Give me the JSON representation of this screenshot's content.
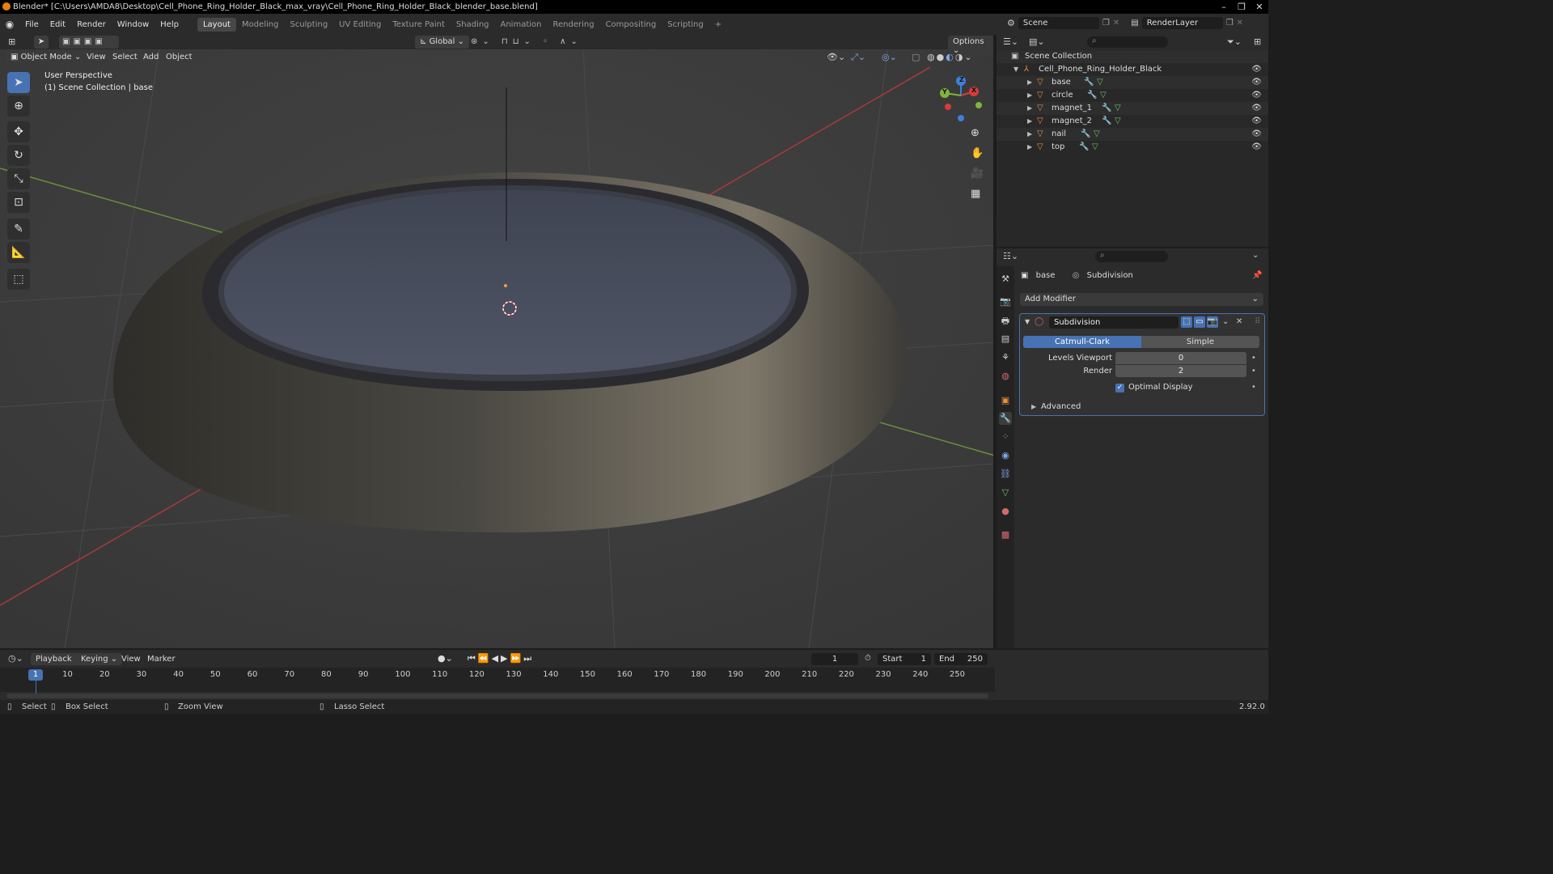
{
  "window": {
    "title": "Blender* [C:\\Users\\AMDA8\\Desktop\\Cell_Phone_Ring_Holder_Black_max_vray\\Cell_Phone_Ring_Holder_Black_blender_base.blend]"
  },
  "menu": [
    "File",
    "Edit",
    "Render",
    "Window",
    "Help"
  ],
  "workspaces": [
    "Layout",
    "Modeling",
    "Sculpting",
    "UV Editing",
    "Texture Paint",
    "Shading",
    "Animation",
    "Rendering",
    "Compositing",
    "Scripting"
  ],
  "active_workspace": "Layout",
  "add_workspace": "+",
  "scene": {
    "name": "Scene",
    "render_layer": "RenderLayer"
  },
  "viewport": {
    "orientation": "Global",
    "options_label": "Options",
    "mode": "Object Mode",
    "menus": [
      "View",
      "Select",
      "Add",
      "Object"
    ],
    "overlay_title": "User Perspective",
    "overlay_subtitle": "(1) Scene Collection | base",
    "gizmo": {
      "x": "X",
      "y": "Y",
      "z": "Z"
    }
  },
  "outliner": {
    "root": "Scene Collection",
    "collection": "Cell_Phone_Ring_Holder_Black",
    "objects": [
      "base",
      "circle",
      "magnet_1",
      "magnet_2",
      "nail",
      "top"
    ]
  },
  "properties": {
    "object_name": "base",
    "modifier_context": "Subdivision",
    "add_modifier": "Add Modifier",
    "modifier": {
      "name": "Subdivision",
      "type_a": "Catmull-Clark",
      "type_b": "Simple",
      "levels_viewport_label": "Levels Viewport",
      "levels_viewport": "0",
      "render_label": "Render",
      "render": "2",
      "optimal_display_label": "Optimal Display",
      "optimal_display": true,
      "advanced_label": "Advanced"
    }
  },
  "timeline": {
    "menus": [
      "Playback",
      "Keying",
      "View",
      "Marker"
    ],
    "current_frame": "1",
    "start_label": "Start",
    "start": "1",
    "end_label": "End",
    "end": "250",
    "ticks": [
      "1",
      "10",
      "20",
      "30",
      "40",
      "50",
      "60",
      "70",
      "80",
      "90",
      "100",
      "110",
      "120",
      "130",
      "140",
      "150",
      "160",
      "170",
      "180",
      "190",
      "200",
      "210",
      "220",
      "230",
      "240",
      "250"
    ]
  },
  "statusbar": {
    "select": "Select",
    "box_select": "Box Select",
    "zoom_view": "Zoom View",
    "lasso_select": "Lasso Select",
    "version": "2.92.0"
  },
  "colors": {
    "accent": "#4772b3",
    "object_orange": "#e8903a",
    "axis_red": "#d83b3b",
    "axis_green": "#7fb539",
    "axis_blue": "#3f7fd9"
  }
}
